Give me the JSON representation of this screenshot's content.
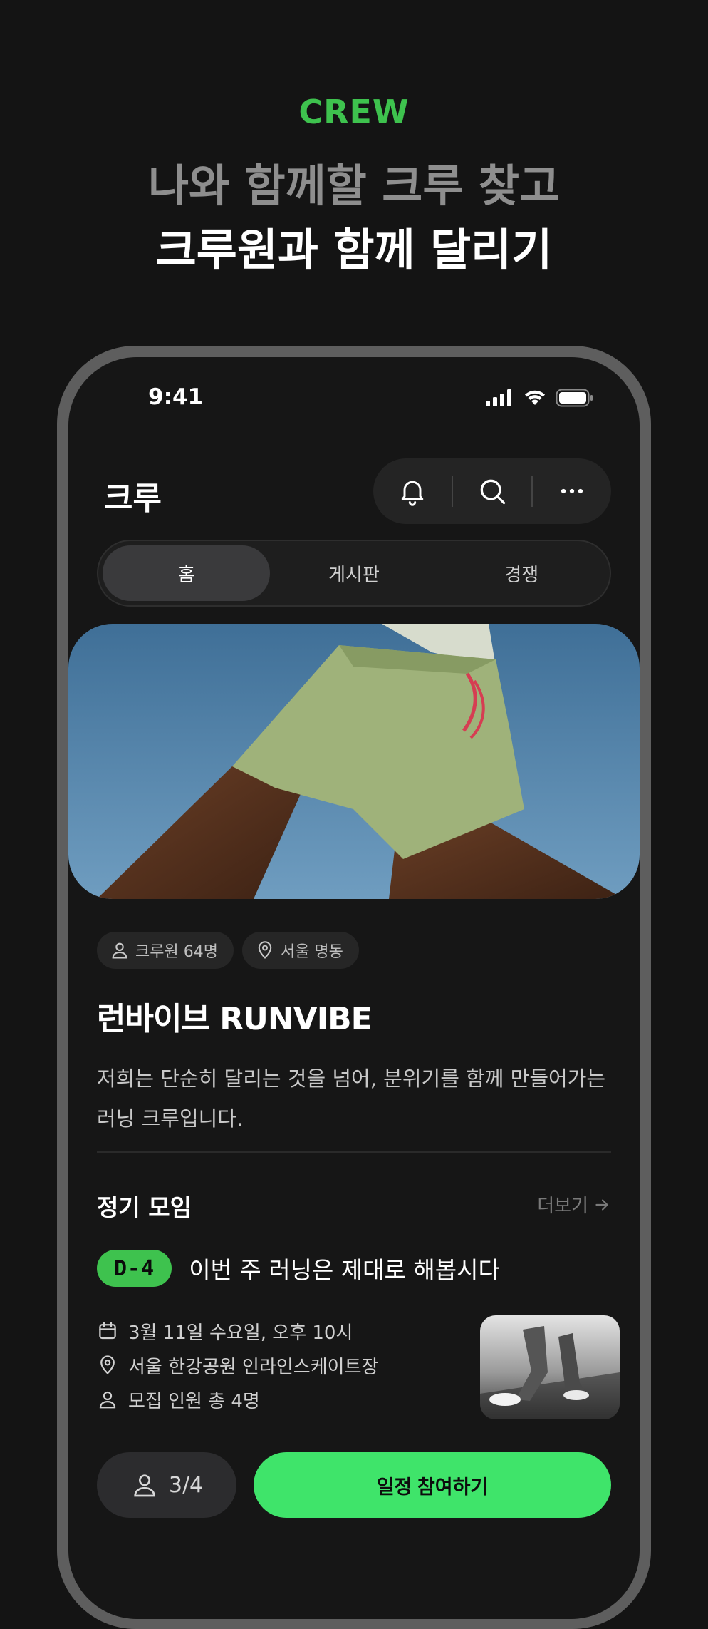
{
  "hero": {
    "kicker": "CREW",
    "headline_line1": "나와 함께할 크루 찾고",
    "headline_line2": "크루원과 함께 달리기"
  },
  "status_bar": {
    "time": "9:41"
  },
  "header": {
    "title": "크루"
  },
  "tabs": [
    {
      "label": "홈",
      "active": true
    },
    {
      "label": "게시판",
      "active": false
    },
    {
      "label": "경쟁",
      "active": false
    }
  ],
  "crew": {
    "member_chip": "크루원 64명",
    "location_chip": "서울 명동",
    "name": "런바이브 RUNVIBE",
    "description": "저희는 단순히 달리는 것을 넘어, 분위기를 함께 만들어가는 러닝 크루입니다."
  },
  "regular_meetup": {
    "section_title": "정기 모임",
    "more_label": "더보기",
    "dday": "D-4",
    "title": "이번 주 러닝은 제대로 해봅시다",
    "datetime": "3월 11일 수요일, 오후 10시",
    "place": "서울 한강공원 인라인스케이트장",
    "recruit": "모집 인원 총 4명",
    "participants": "3/4",
    "join_label": "일정 참여하기"
  },
  "colors": {
    "accent_green": "#3ec24e",
    "join_green": "#3fe46a",
    "background": "#141414"
  }
}
